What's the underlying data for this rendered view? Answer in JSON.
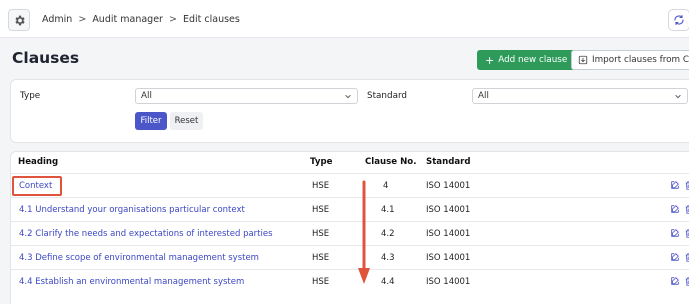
{
  "breadcrumb": {
    "root": "Admin",
    "section": "Audit manager",
    "current": "Edit clauses",
    "separator": ">"
  },
  "page": {
    "title": "Clauses"
  },
  "actions": {
    "add_label": "Add new clause",
    "add_prefix": "+",
    "import_label": "Import clauses from CSV"
  },
  "filters": {
    "type_label": "Type",
    "type_value": "All",
    "standard_label": "Standard",
    "standard_value": "All",
    "filter_button": "Filter",
    "reset_button": "Reset"
  },
  "table": {
    "headers": {
      "heading": "Heading",
      "type": "Type",
      "clause_no": "Clause No.",
      "standard": "Standard"
    },
    "rows": [
      {
        "heading": "Context",
        "type": "HSE",
        "clause_no": "4",
        "standard": "ISO 14001"
      },
      {
        "heading": "4.1 Understand your organisations particular context",
        "type": "HSE",
        "clause_no": "4.1",
        "standard": "ISO 14001"
      },
      {
        "heading": "4.2 Clarify the needs and expectations of interested parties",
        "type": "HSE",
        "clause_no": "4.2",
        "standard": "ISO 14001"
      },
      {
        "heading": "4.3 Define scope of environmental management system",
        "type": "HSE",
        "clause_no": "4.3",
        "standard": "ISO 14001"
      },
      {
        "heading": "4.4 Establish an environmental management system",
        "type": "HSE",
        "clause_no": "4.4",
        "standard": "ISO 14001"
      }
    ]
  },
  "colors": {
    "primary": "#4b57c8",
    "success": "#2e9b5b",
    "link": "#3a47c4",
    "annotation": "#e0533c"
  },
  "icons": [
    "gear-icon",
    "sync-icon",
    "plus-icon",
    "import-icon",
    "chevron-down-icon",
    "edit-icon",
    "trash-icon",
    "arrow-down-icon"
  ]
}
